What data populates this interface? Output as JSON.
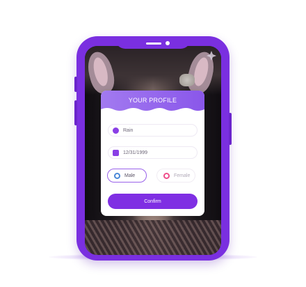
{
  "profile": {
    "title": "YOUR PROFILE",
    "name_value": "Rain",
    "dob_value": "12/31/1999",
    "gender_options": [
      {
        "label": "Male",
        "selected": true
      },
      {
        "label": "Female",
        "selected": false
      }
    ],
    "confirm_label": "Confirm"
  },
  "colors": {
    "accent": "#7f2fe3",
    "phone": "#7a2fe0",
    "male_icon": "#4b88d8",
    "female_icon": "#ef4f8a"
  },
  "icons": {
    "name_field": "person-icon",
    "dob_field": "calendar-icon",
    "male": "male-icon",
    "female": "female-icon"
  }
}
